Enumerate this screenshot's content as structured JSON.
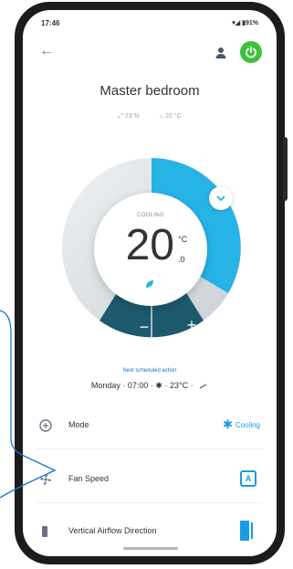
{
  "status_bar": {
    "time": "17:46",
    "indicators": "▾◢ ▮91%"
  },
  "header": {
    "back_icon": "arrow-left-icon",
    "person_icon": "person-icon",
    "power_icon": "power-icon",
    "power_color": "#3cc13c"
  },
  "room": {
    "title": "Master bedroom",
    "humidity": "23 %",
    "indoor_temp": "20 °C"
  },
  "thermostat": {
    "mode_label": "COOLING",
    "temperature": "20",
    "unit": "°C",
    "decimal": ".0",
    "minus_label": "−",
    "plus_label": "+",
    "accent_color": "#28b3e6",
    "dark_color": "#1d5a6e"
  },
  "schedule": {
    "label": "Next scheduled action",
    "text": "Monday · 07:00 · ✱ · 23°C ·"
  },
  "settings": [
    {
      "label": "Mode",
      "value": "Cooling",
      "icon": "mode-icon"
    },
    {
      "label": "Fan Speed",
      "value": "A",
      "icon": "fan-icon"
    },
    {
      "label": "Vertical Airflow Direction",
      "icon": "airflow-icon"
    }
  ]
}
